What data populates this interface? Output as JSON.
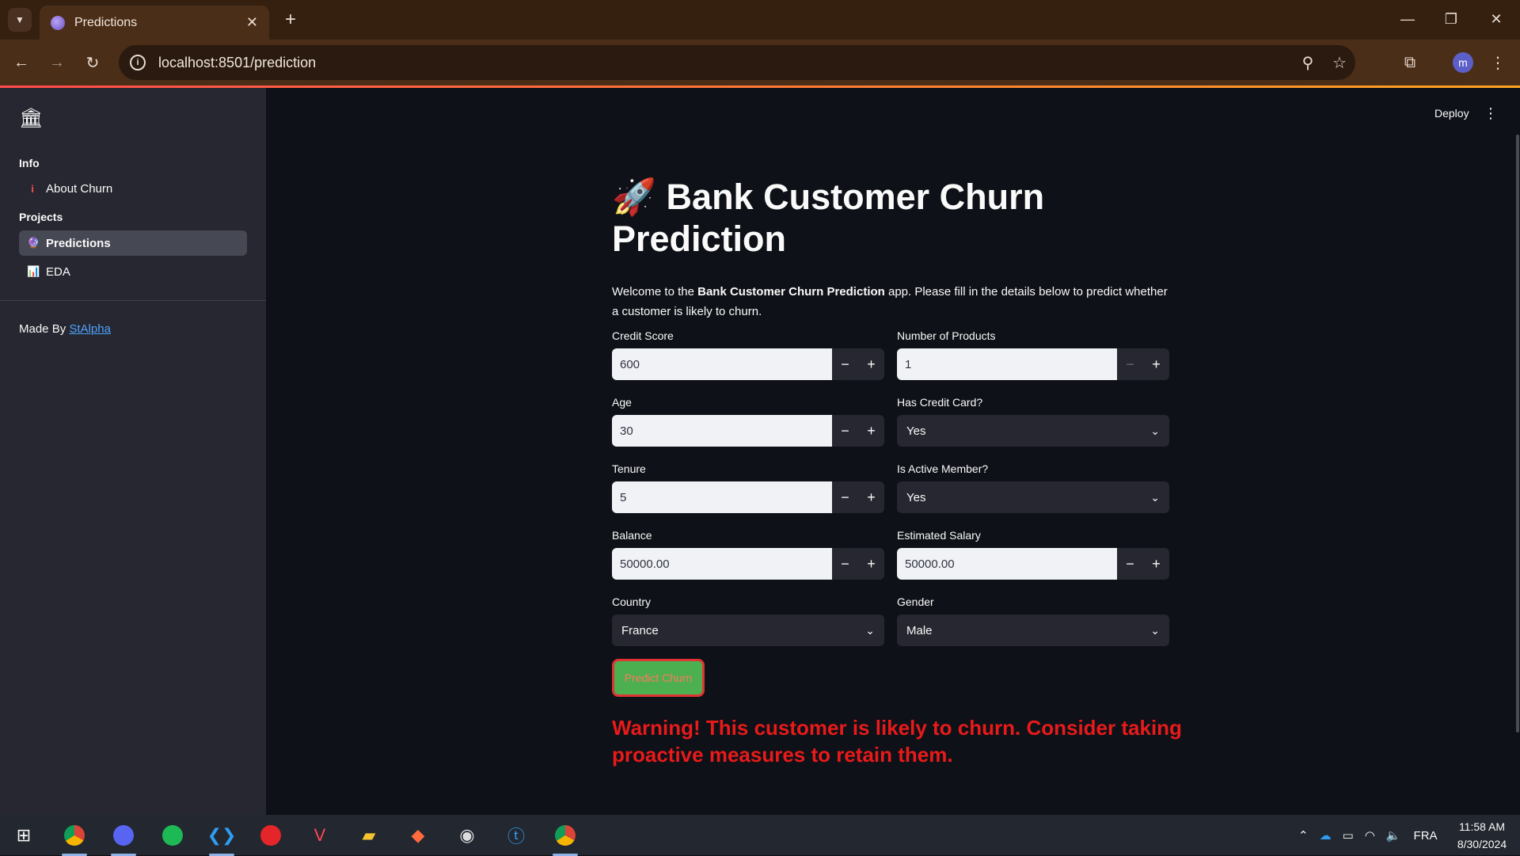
{
  "browser": {
    "tab_title": "Predictions",
    "url": "localhost:8501/prediction",
    "profile_initial": "m"
  },
  "sidebar": {
    "info_section": "Info",
    "about_item": "About Churn",
    "projects_section": "Projects",
    "predictions_item": "Predictions",
    "eda_item": "EDA",
    "made_by_prefix": "Made By ",
    "made_by_link": "StAlpha"
  },
  "header": {
    "deploy_label": "Deploy"
  },
  "main": {
    "title_emoji": "🚀",
    "title": "Bank Customer Churn Prediction",
    "intro_prefix": "Welcome to the ",
    "intro_bold": "Bank Customer Churn Prediction",
    "intro_suffix": " app. Please fill in the details below to predict whether a customer is likely to churn.",
    "fields": {
      "credit_score": {
        "label": "Credit Score",
        "value": "600"
      },
      "num_products": {
        "label": "Number of Products",
        "value": "1"
      },
      "age": {
        "label": "Age",
        "value": "30"
      },
      "has_credit_card": {
        "label": "Has Credit Card?",
        "value": "Yes"
      },
      "tenure": {
        "label": "Tenure",
        "value": "5"
      },
      "is_active": {
        "label": "Is Active Member?",
        "value": "Yes"
      },
      "balance": {
        "label": "Balance",
        "value": "50000.00"
      },
      "salary": {
        "label": "Estimated Salary",
        "value": "50000.00"
      },
      "country": {
        "label": "Country",
        "value": "France"
      },
      "gender": {
        "label": "Gender",
        "value": "Male"
      }
    },
    "predict_button": "Predict Churn",
    "warning": "Warning! This customer is likely to churn. Consider taking proactive measures to retain them."
  },
  "taskbar": {
    "language": "FRA",
    "time": "11:58 AM",
    "date": "8/30/2024"
  },
  "colors": {
    "accent_warning": "#e81a1a",
    "predict_button_bg": "#4caf50",
    "link": "#4ea3ff"
  }
}
